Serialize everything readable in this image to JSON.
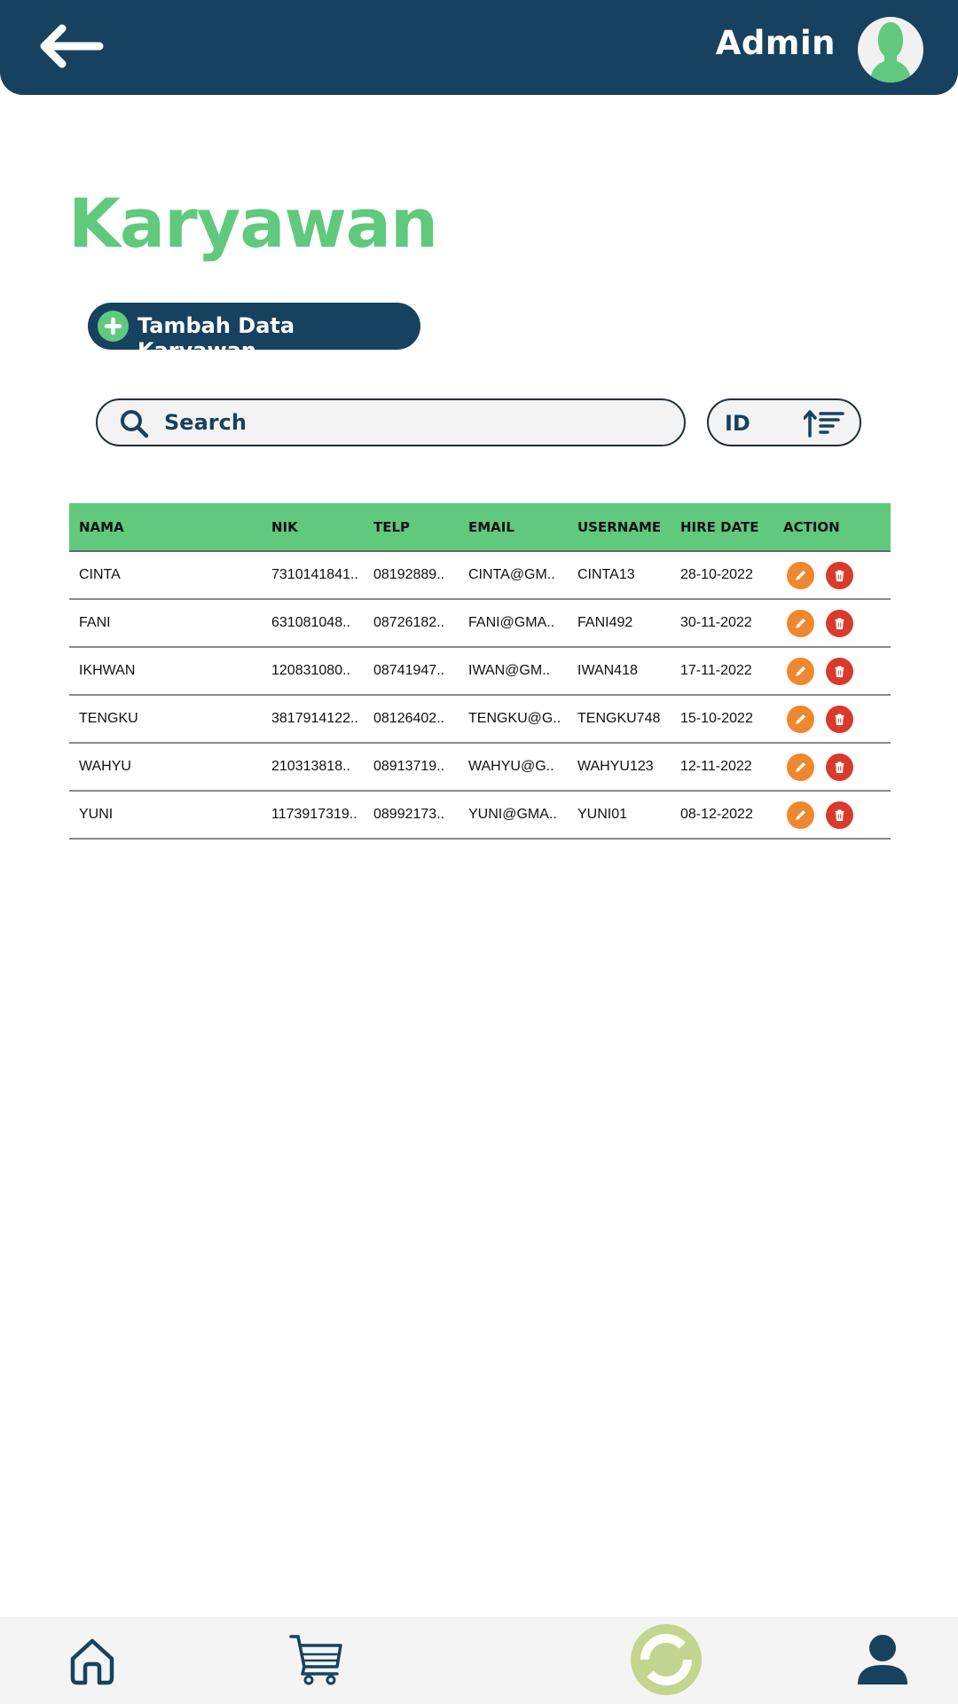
{
  "header": {
    "back_icon": "arrow-left-icon",
    "user_name": "Admin",
    "avatar_icon": "user-avatar-icon"
  },
  "page": {
    "title": "Karyawan"
  },
  "add_button": {
    "label": "Tambah Data Karyawan",
    "icon": "plus-circle-icon"
  },
  "search": {
    "placeholder": "Search",
    "value": ""
  },
  "sort": {
    "field": "ID",
    "icon": "sort-ascending-icon"
  },
  "table": {
    "headers": [
      "NAMA",
      "NIK",
      "TELP",
      "EMAIL",
      "USERNAME",
      "HIRE DATE",
      "ACTION"
    ],
    "rows": [
      [
        "CINTA",
        "7310141841..",
        "08192889..",
        "CINTA@GM..",
        "CINTA13",
        "28-10-2022"
      ],
      [
        "FANI",
        "631081048..",
        "08726182..",
        "FANI@GMA..",
        "FANI492",
        "30-11-2022"
      ],
      [
        "IKHWAN",
        "120831080..",
        "08741947..",
        "IWAN@GM..",
        "IWAN418",
        "17-11-2022"
      ],
      [
        "TENGKU",
        "3817914122..",
        "08126402..",
        "TENGKU@G..",
        "TENGKU748",
        "15-10-2022"
      ],
      [
        "WAHYU",
        "210313818..",
        "08913719..",
        "WAHYU@G..",
        "WAHYU123",
        "12-11-2022"
      ],
      [
        "YUNI",
        "1173917319..",
        "08992173..",
        "YUNI@GMA..",
        "YUNI01",
        "08-12-2022"
      ]
    ]
  },
  "bottom_nav": {
    "items": [
      "home-icon",
      "cart-icon",
      "sync-icon",
      "profile-icon"
    ]
  },
  "colors": {
    "primary": "#17425f",
    "accent": "#60c97d",
    "edit": "#f0862e",
    "delete": "#d93a2b",
    "nav_active": "#c3d58e"
  }
}
